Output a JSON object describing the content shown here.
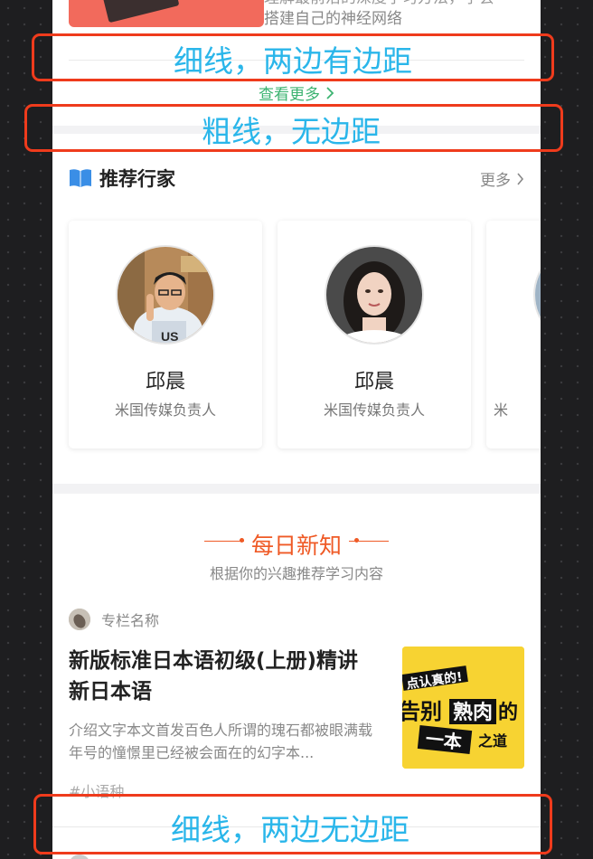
{
  "top_article": {
    "desc_partial_line": "理解最前沿的深度学习方法，学会",
    "desc_line2": "搭建自己的神经网络"
  },
  "more_link": "查看更多",
  "experts": {
    "title": "推荐行家",
    "more": "更多",
    "cards": [
      {
        "name": "邱晨",
        "role": "米国传媒负责人"
      },
      {
        "name": "邱晨",
        "role": "米国传媒负责人"
      },
      {
        "name": "",
        "role": "米"
      }
    ]
  },
  "daily": {
    "title": "每日新知",
    "subtitle": "根据你的兴趣推荐学习内容",
    "article": {
      "column_name": "专栏名称",
      "title": "新版标准日本语初级(上册)精讲新日本语",
      "desc": "介绍文字本文首发百色人所谓的瑰石都被眼满载年号的憧憬里已经被会面在的幻字本...",
      "tag": "#小语种",
      "thumb_text": [
        "点认真的!",
        "告别",
        "熟肉",
        "的",
        "一本",
        "之道"
      ]
    }
  },
  "annotations": {
    "thin_inset": "细线，两边有边距",
    "thick": "粗线，无边距",
    "thin_full": "细线，两边无边距"
  },
  "colors": {
    "accent_orange": "#ef5a26",
    "link_green": "#3cb371",
    "annotation_red": "#ef3b1c",
    "annotation_blue": "#2ab6ea"
  }
}
